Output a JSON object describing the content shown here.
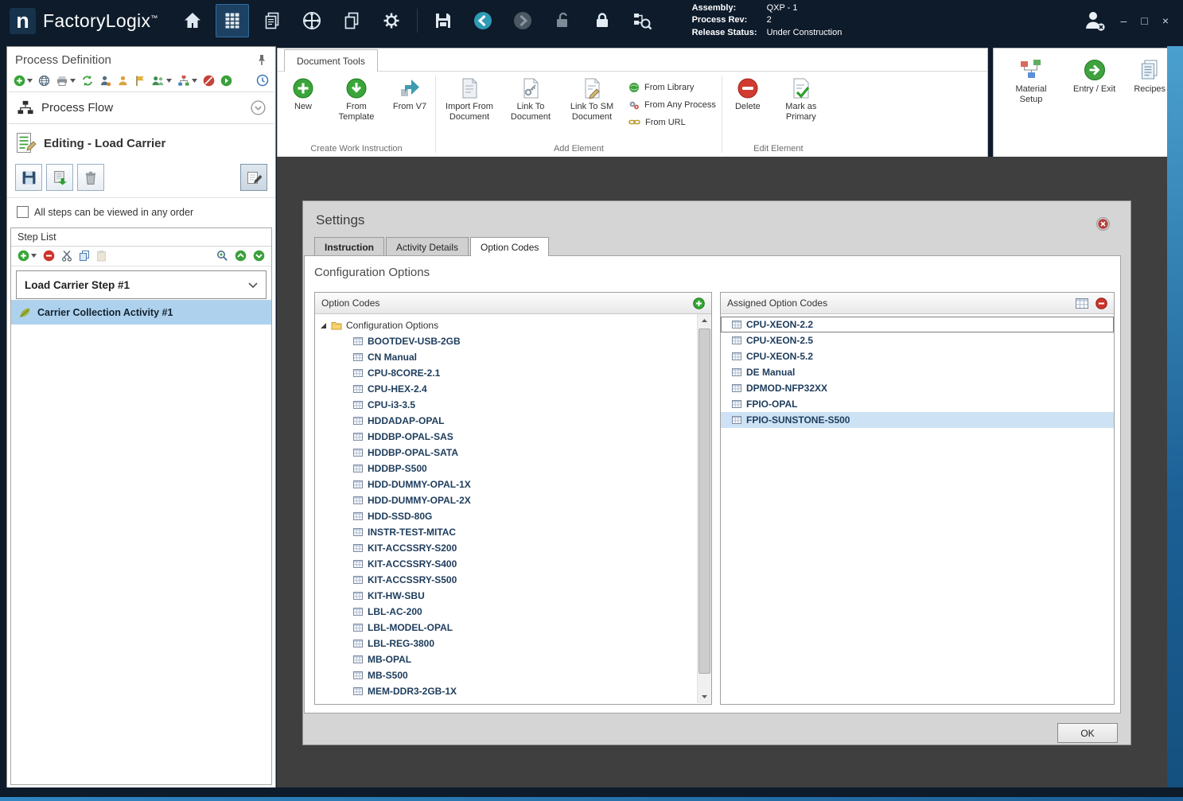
{
  "colors": {
    "titlebar_bg": "#0d1b2b",
    "content_bg": "#3f3f3f",
    "selection_blue": "#cde3f5",
    "tree_text": "#1d3c5c",
    "accent_green": "#37a437",
    "accent_red": "#c93a30"
  },
  "titlebar": {
    "logo_letter": "n",
    "app_name": "FactoryLogix",
    "trademark": "™",
    "info": {
      "assembly_label": "Assembly:",
      "assembly_value": "QXP - 1",
      "process_rev_label": "Process Rev:",
      "process_rev_value": "2",
      "release_status_label": "Release Status:",
      "release_status_value": "Under Construction"
    },
    "window_controls": {
      "minimize": "–",
      "maximize": "□",
      "close": "×"
    }
  },
  "sidebar": {
    "title": "Process Definition",
    "process_flow": {
      "label": "Process Flow"
    },
    "editing": {
      "label": "Editing - Load Carrier"
    },
    "order_checkbox": {
      "label": "All steps can be viewed in any order",
      "checked": false
    },
    "step_list": {
      "title": "Step List",
      "step": {
        "label": "Load Carrier Step #1"
      },
      "activity": {
        "label": "Carrier Collection Activity #1"
      }
    }
  },
  "ribbon": {
    "tab_label": "Document Tools",
    "groups": [
      {
        "label": "Create Work Instruction",
        "items": [
          {
            "label": "New"
          },
          {
            "label": "From Template"
          },
          {
            "label": "From V7"
          }
        ]
      },
      {
        "label": "Add Element",
        "items": [
          {
            "label": "Import From Document"
          },
          {
            "label": "Link To Document"
          },
          {
            "label": "Link To SM Document"
          },
          {
            "label": "From Library"
          },
          {
            "label": "From Any Process"
          },
          {
            "label": "From URL"
          }
        ]
      },
      {
        "label": "Edit Element",
        "items": [
          {
            "label": "Delete"
          },
          {
            "label": "Mark as Primary"
          }
        ]
      }
    ],
    "right_items": [
      {
        "label": "Material Setup"
      },
      {
        "label": "Entry / Exit"
      },
      {
        "label": "Recipes"
      }
    ]
  },
  "settings": {
    "title": "Settings",
    "tabs": [
      {
        "label": "Instruction"
      },
      {
        "label": "Activity Details"
      },
      {
        "label": "Option Codes"
      }
    ],
    "active_tab": "Option Codes",
    "section_title": "Configuration Options",
    "left_panel": {
      "header": "Option Codes",
      "root_label": "Configuration Options",
      "items": [
        "BOOTDEV-USB-2GB",
        "CN Manual",
        "CPU-8CORE-2.1",
        "CPU-HEX-2.4",
        "CPU-i3-3.5",
        "HDDADAP-OPAL",
        "HDDBP-OPAL-SAS",
        "HDDBP-OPAL-SATA",
        "HDDBP-S500",
        "HDD-DUMMY-OPAL-1X",
        "HDD-DUMMY-OPAL-2X",
        "HDD-SSD-80G",
        "INSTR-TEST-MITAC",
        "KIT-ACCSSRY-S200",
        "KIT-ACCSSRY-S400",
        "KIT-ACCSSRY-S500",
        "KIT-HW-SBU",
        "LBL-AC-200",
        "LBL-MODEL-OPAL",
        "LBL-REG-3800",
        "MB-OPAL",
        "MB-S500",
        "MEM-DDR3-2GB-1X"
      ]
    },
    "right_panel": {
      "header": "Assigned Option Codes",
      "items": [
        "CPU-XEON-2.2",
        "CPU-XEON-2.5",
        "CPU-XEON-5.2",
        "DE Manual",
        "DPMOD-NFP32XX",
        "FPIO-OPAL",
        "FPIO-SUNSTONE-S500"
      ],
      "focused_index": 0,
      "selected_index": 6
    },
    "ok_label": "OK"
  }
}
